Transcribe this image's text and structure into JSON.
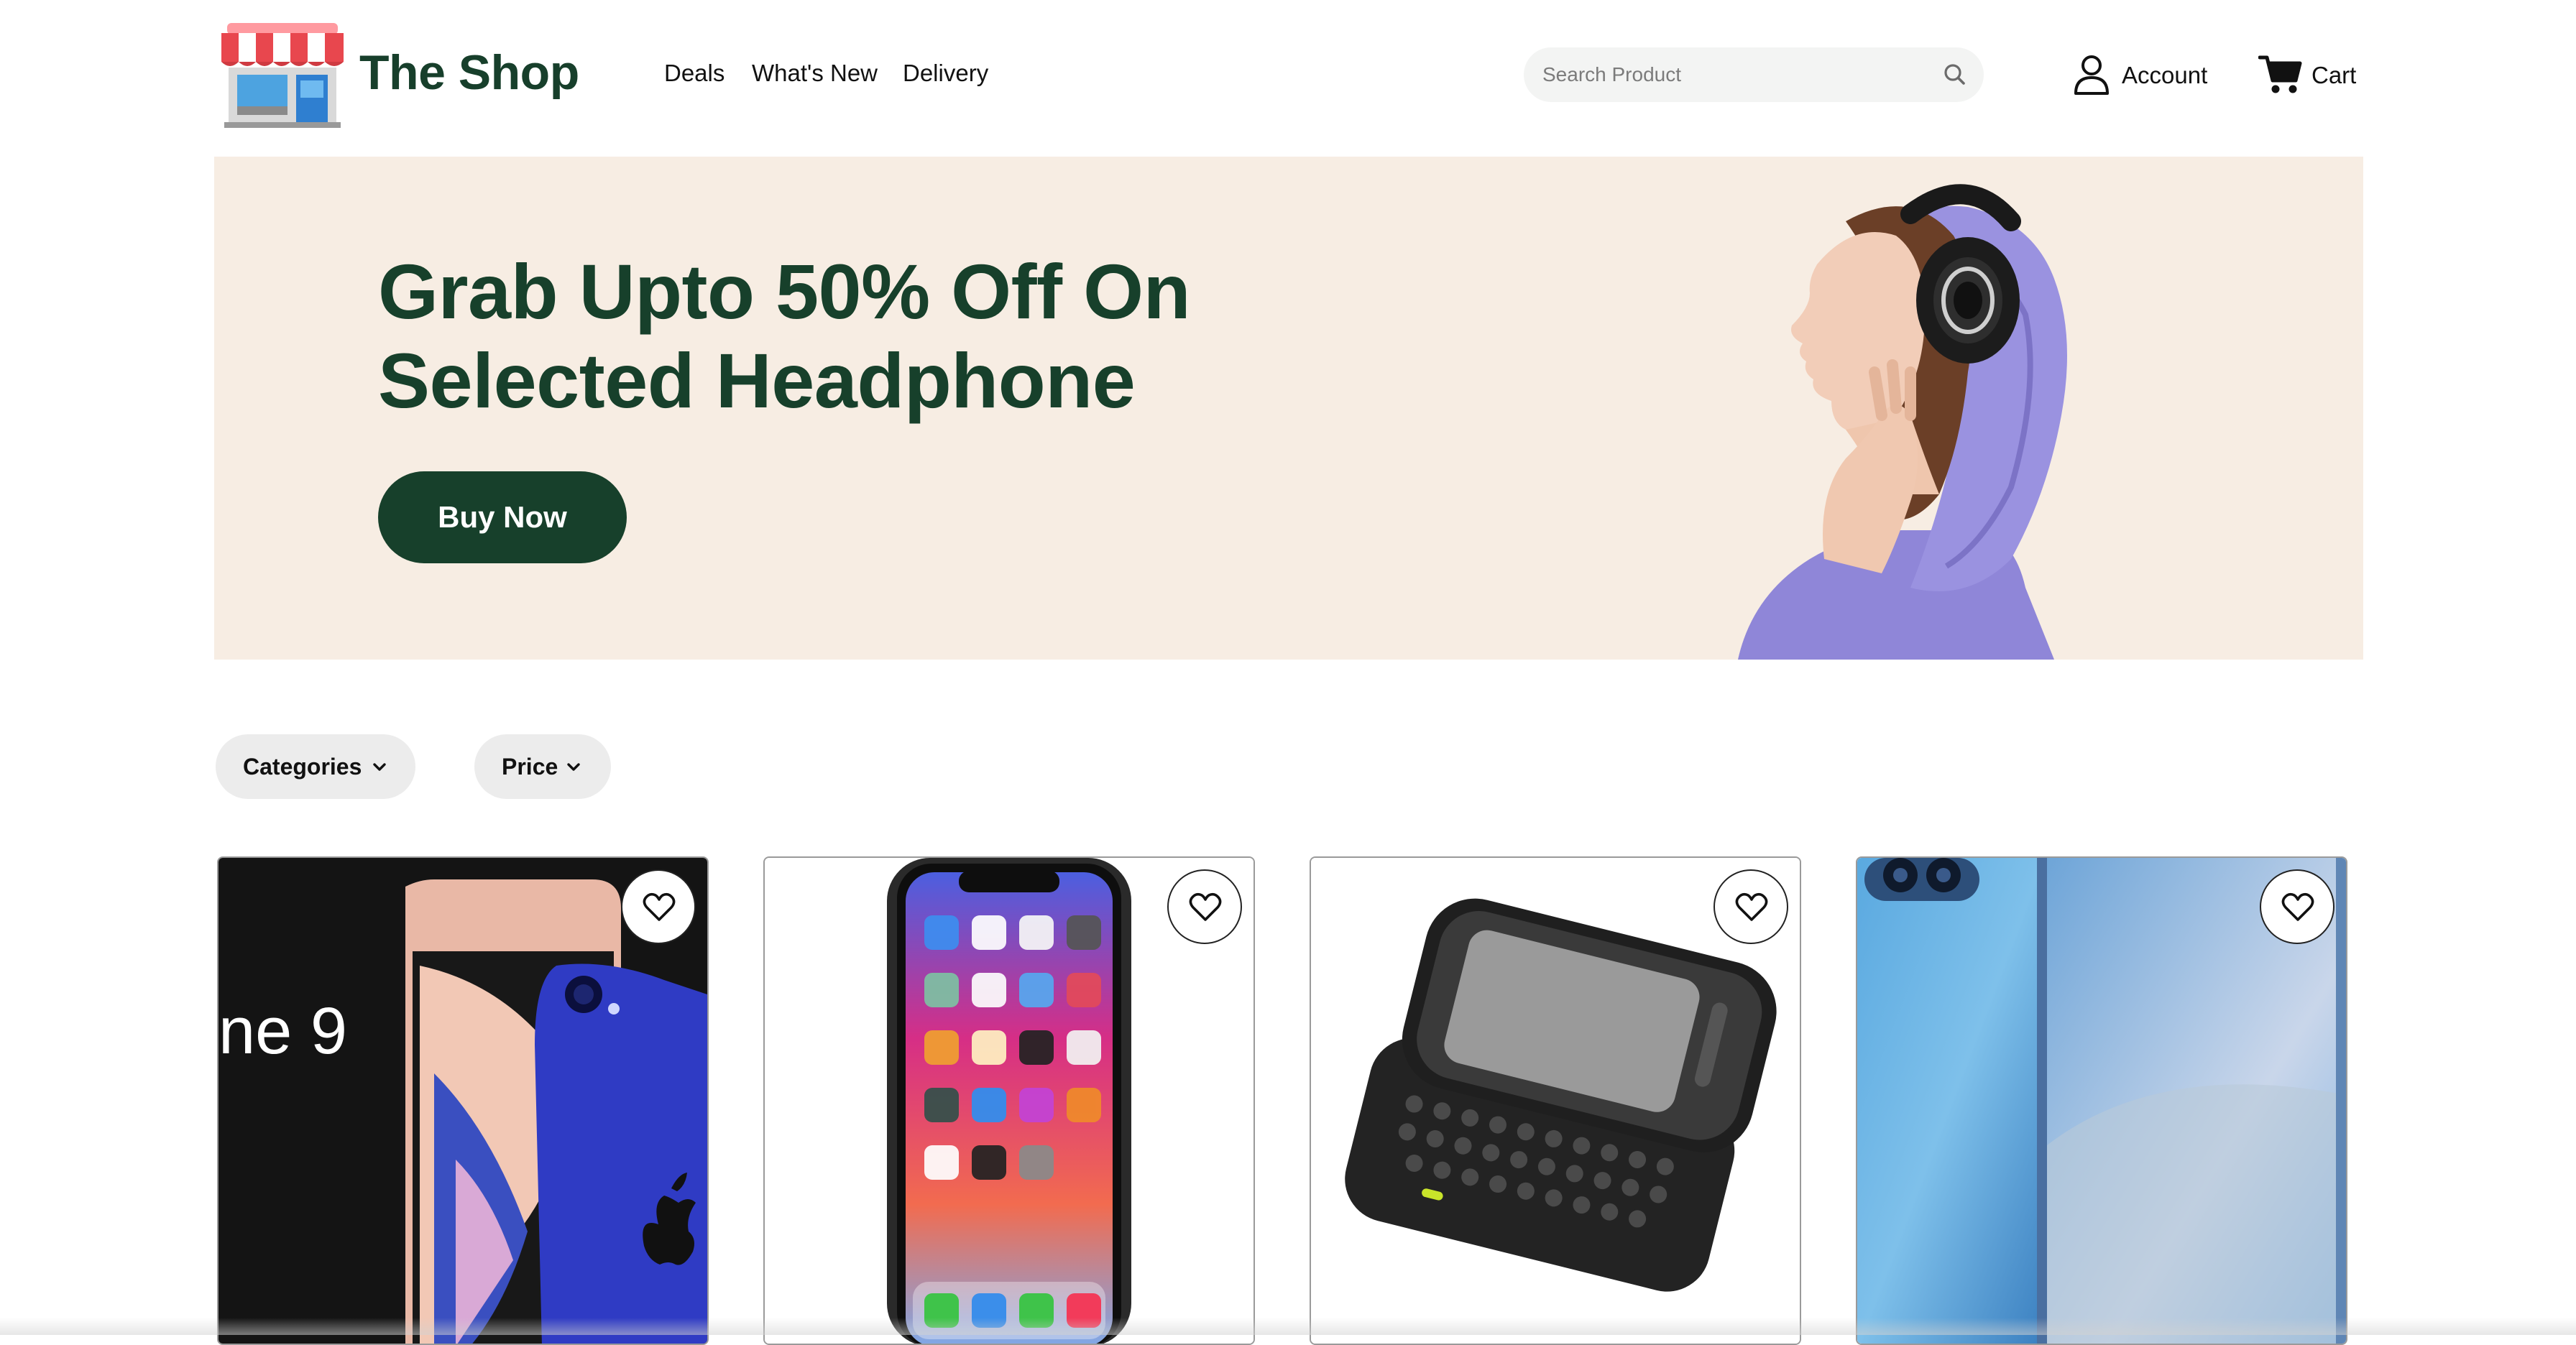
{
  "header": {
    "brand": "The Shop",
    "nav": [
      "Deals",
      "What's New",
      "Delivery"
    ],
    "search_placeholder": "Search Product",
    "account_label": "Account",
    "cart_label": "Cart"
  },
  "hero": {
    "title_line1": "Grab Upto 50% Off On",
    "title_line2": "Selected Headphone",
    "button_label": "Buy Now"
  },
  "filters": {
    "categories_label": "Categories",
    "price_label": "Price"
  },
  "products": [
    {
      "image": "iphone-9-promo",
      "phone_text": "ne 9"
    },
    {
      "image": "iphone-x-front"
    },
    {
      "image": "slider-keyboard-phone"
    },
    {
      "image": "blue-android-phone"
    }
  ],
  "colors": {
    "brand_green": "#17402b",
    "hero_bg": "#f7ede3",
    "filter_bg": "#ececec",
    "search_bg": "#f3f4f3"
  }
}
